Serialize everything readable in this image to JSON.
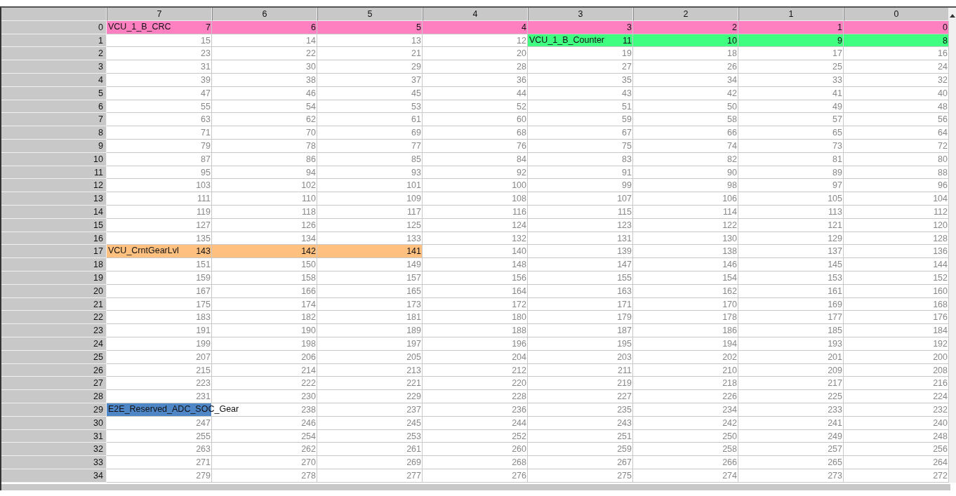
{
  "columns": [
    "7",
    "6",
    "5",
    "4",
    "3",
    "2",
    "1",
    "0"
  ],
  "rows": [
    {
      "label": "0",
      "cells": [
        {
          "text": "7",
          "signal": "VCU_1_B_CRC",
          "color": "#ff80c0"
        },
        {
          "text": "6",
          "color": "#ff80c0"
        },
        {
          "text": "5",
          "color": "#ff80c0"
        },
        {
          "text": "4",
          "color": "#ff80c0"
        },
        {
          "text": "3",
          "color": "#ff80c0"
        },
        {
          "text": "2",
          "color": "#ff80c0"
        },
        {
          "text": "1",
          "color": "#ff80c0"
        },
        {
          "text": "0",
          "color": "#ff80c0"
        }
      ]
    },
    {
      "label": "1",
      "cells": [
        "15",
        "14",
        "13",
        "12",
        {
          "text": "11",
          "signal": "VCU_1_B_Counter",
          "color": "#40ff80"
        },
        {
          "text": "10",
          "color": "#40ff80"
        },
        {
          "text": "9",
          "color": "#40ff80"
        },
        {
          "text": "8",
          "color": "#40ff80"
        }
      ]
    },
    {
      "label": "2",
      "cells": [
        "23",
        "22",
        "21",
        "20",
        "19",
        "18",
        "17",
        "16"
      ]
    },
    {
      "label": "3",
      "cells": [
        "31",
        "30",
        "29",
        "28",
        "27",
        "26",
        "25",
        "24"
      ]
    },
    {
      "label": "4",
      "cells": [
        "39",
        "38",
        "37",
        "36",
        "35",
        "34",
        "33",
        "32"
      ]
    },
    {
      "label": "5",
      "cells": [
        "47",
        "46",
        "45",
        "44",
        "43",
        "42",
        "41",
        "40"
      ]
    },
    {
      "label": "6",
      "cells": [
        "55",
        "54",
        "53",
        "52",
        "51",
        "50",
        "49",
        "48"
      ]
    },
    {
      "label": "7",
      "cells": [
        "63",
        "62",
        "61",
        "60",
        "59",
        "58",
        "57",
        "56"
      ]
    },
    {
      "label": "8",
      "cells": [
        "71",
        "70",
        "69",
        "68",
        "67",
        "66",
        "65",
        "64"
      ]
    },
    {
      "label": "9",
      "cells": [
        "79",
        "78",
        "77",
        "76",
        "75",
        "74",
        "73",
        "72"
      ]
    },
    {
      "label": "10",
      "cells": [
        "87",
        "86",
        "85",
        "84",
        "83",
        "82",
        "81",
        "80"
      ]
    },
    {
      "label": "11",
      "cells": [
        "95",
        "94",
        "93",
        "92",
        "91",
        "90",
        "89",
        "88"
      ]
    },
    {
      "label": "12",
      "cells": [
        "103",
        "102",
        "101",
        "100",
        "99",
        "98",
        "97",
        "96"
      ]
    },
    {
      "label": "13",
      "cells": [
        "111",
        "110",
        "109",
        "108",
        "107",
        "106",
        "105",
        "104"
      ]
    },
    {
      "label": "14",
      "cells": [
        "119",
        "118",
        "117",
        "116",
        "115",
        "114",
        "113",
        "112"
      ]
    },
    {
      "label": "15",
      "cells": [
        "127",
        "126",
        "125",
        "124",
        "123",
        "122",
        "121",
        "120"
      ]
    },
    {
      "label": "16",
      "cells": [
        "135",
        "134",
        "133",
        "132",
        "131",
        "130",
        "129",
        "128"
      ]
    },
    {
      "label": "17",
      "cells": [
        {
          "text": "143",
          "signal": "VCU_CrntGearLvl",
          "color": "#ffc080"
        },
        {
          "text": "142",
          "color": "#ffc080"
        },
        {
          "text": "141",
          "color": "#ffc080"
        },
        "140",
        "139",
        "138",
        "137",
        "136"
      ]
    },
    {
      "label": "18",
      "cells": [
        "151",
        "150",
        "149",
        "148",
        "147",
        "146",
        "145",
        "144"
      ]
    },
    {
      "label": "19",
      "cells": [
        "159",
        "158",
        "157",
        "156",
        "155",
        "154",
        "153",
        "152"
      ]
    },
    {
      "label": "20",
      "cells": [
        "167",
        "166",
        "165",
        "164",
        "163",
        "162",
        "161",
        "160"
      ]
    },
    {
      "label": "21",
      "cells": [
        "175",
        "174",
        "173",
        "172",
        "171",
        "170",
        "169",
        "168"
      ]
    },
    {
      "label": "22",
      "cells": [
        "183",
        "182",
        "181",
        "180",
        "179",
        "178",
        "177",
        "176"
      ]
    },
    {
      "label": "23",
      "cells": [
        "191",
        "190",
        "189",
        "188",
        "187",
        "186",
        "185",
        "184"
      ]
    },
    {
      "label": "24",
      "cells": [
        "199",
        "198",
        "197",
        "196",
        "195",
        "194",
        "193",
        "192"
      ]
    },
    {
      "label": "25",
      "cells": [
        "207",
        "206",
        "205",
        "204",
        "203",
        "202",
        "201",
        "200"
      ]
    },
    {
      "label": "26",
      "cells": [
        "215",
        "214",
        "213",
        "212",
        "211",
        "210",
        "209",
        "208"
      ]
    },
    {
      "label": "27",
      "cells": [
        "223",
        "222",
        "221",
        "220",
        "219",
        "218",
        "217",
        "216"
      ]
    },
    {
      "label": "28",
      "cells": [
        "231",
        "230",
        "229",
        "228",
        "227",
        "226",
        "225",
        "224"
      ]
    },
    {
      "label": "29",
      "cells": [
        {
          "signal": "E2E_Reserved_ADC_SOC_Gear",
          "color": "#4f86c6"
        },
        "238",
        "237",
        "236",
        "235",
        "234",
        "233",
        "232"
      ]
    },
    {
      "label": "30",
      "cells": [
        "247",
        "246",
        "245",
        "244",
        "243",
        "242",
        "241",
        "240"
      ]
    },
    {
      "label": "31",
      "cells": [
        "255",
        "254",
        "253",
        "252",
        "251",
        "250",
        "249",
        "248"
      ]
    },
    {
      "label": "32",
      "cells": [
        "263",
        "262",
        "261",
        "260",
        "259",
        "258",
        "257",
        "256"
      ]
    },
    {
      "label": "33",
      "cells": [
        "271",
        "270",
        "269",
        "268",
        "267",
        "266",
        "265",
        "264"
      ]
    },
    {
      "label": "34",
      "cells": [
        "279",
        "278",
        "277",
        "276",
        "275",
        "274",
        "273",
        "272"
      ]
    }
  ]
}
